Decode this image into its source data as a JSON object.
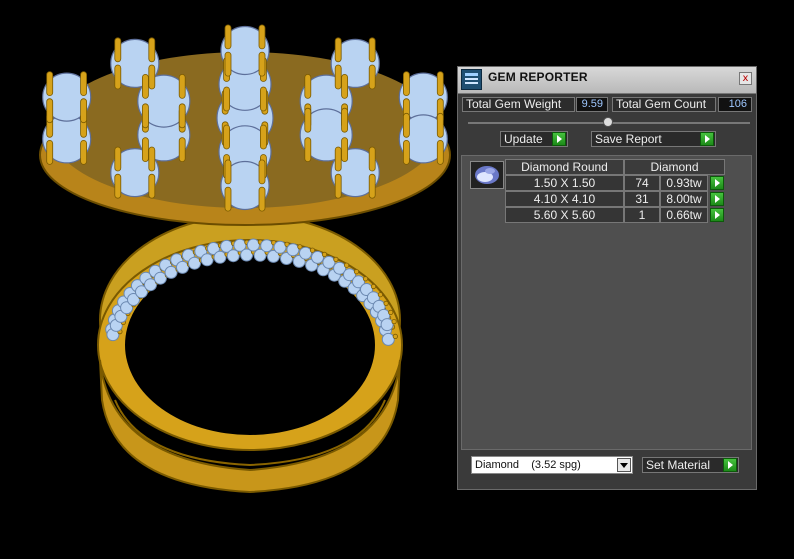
{
  "window": {
    "title": "GEM REPORTER",
    "close_label": "x"
  },
  "stats": {
    "total_weight_label": "Total Gem Weight",
    "total_weight_value": "9.59",
    "total_count_label": "Total Gem Count",
    "total_count_value": "106"
  },
  "buttons": {
    "update_label": "Update",
    "save_report_label": "Save Report",
    "set_material_label": "Set Material"
  },
  "table": {
    "headers": [
      "Diamond Round",
      "Diamond"
    ],
    "rows": [
      {
        "size": "1.50 X 1.50",
        "count": "74",
        "weight": "0.93tw"
      },
      {
        "size": "4.10 X 4.10",
        "count": "31",
        "weight": "8.00tw"
      },
      {
        "size": "5.60 X 5.60",
        "count": "1",
        "weight": "0.66tw"
      }
    ]
  },
  "material": {
    "selected": "Diamond    (3.52 spg)"
  },
  "icons": {
    "title_icon": "gem-reporter-icon",
    "gem_thumb": "diamond-gem-icon",
    "row_arrow": "play-arrow-icon"
  },
  "colors": {
    "gold": "#d6a21a",
    "gem": "#b9d3f2",
    "panel_bg": "#3a3a3a",
    "accent_green": "#2fa82a"
  }
}
